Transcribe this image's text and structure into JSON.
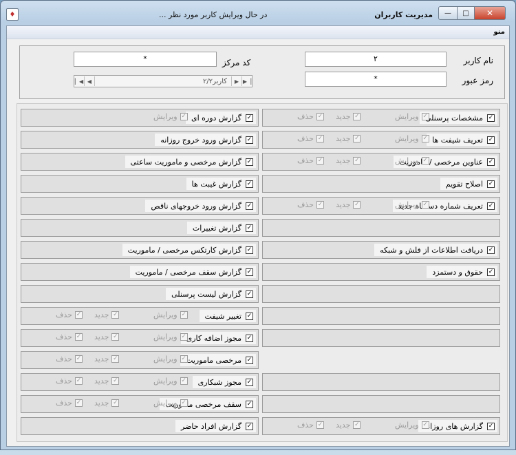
{
  "window": {
    "title": "مدیریت کاربران",
    "subtitle": "در حال ویرایش کاربر مورد نظر ...",
    "app_icon": "app-icon",
    "minimize_glyph": "—",
    "maximize_glyph": "□",
    "close_glyph": "✕"
  },
  "menu": {
    "label": "منو"
  },
  "form": {
    "username_label": "نام کاربر",
    "username_value": "٢",
    "password_label": "رمز عبور",
    "password_value": "*",
    "center_label": "کد مرکز",
    "center_value": "*",
    "nav_text": "کاربر۲/۲",
    "nav_first": "▏◀",
    "nav_prev": "◀",
    "nav_next": "▶",
    "nav_last": "▶▕"
  },
  "perm_labels": {
    "edit": "ویرایش",
    "new": "جدید",
    "delete": "حذف"
  },
  "check_glyph": "✓",
  "right_column": [
    {
      "label": "مشخصات پرسنلی",
      "perms": [
        "edit",
        "new",
        "delete"
      ]
    },
    {
      "label": "تعریف شیفت ها",
      "perms": [
        "edit",
        "new",
        "delete"
      ]
    },
    {
      "label": "عناوین مرخصی / ماموریت",
      "perms": [
        "edit",
        "new",
        "delete"
      ]
    },
    {
      "label": "اصلاح تقویم",
      "perms": []
    },
    {
      "label": "تعریف شماره دستگاه جدید",
      "perms": [
        "edit",
        "new",
        "delete"
      ]
    },
    {
      "label": "",
      "perms": []
    },
    {
      "label": "دریافت اطلاعات از فلش و شبکه",
      "perms": []
    },
    {
      "label": "حقوق و دستمزد",
      "perms": []
    },
    {
      "label": "",
      "perms": []
    },
    {
      "label": "",
      "perms": []
    },
    {
      "label": "",
      "perms": []
    },
    null,
    {
      "label": "",
      "perms": []
    },
    {
      "label": "",
      "perms": []
    },
    {
      "label": "گزارش های روزانه",
      "perms": [
        "edit",
        "new",
        "delete"
      ]
    }
  ],
  "left_column": [
    {
      "label": "گزارش دوره ای",
      "perms": [
        "edit"
      ]
    },
    {
      "label": "گزارش ورود خروج روزانه",
      "perms": []
    },
    {
      "label": "گزارش مرخصی و ماموریت ساعتی",
      "perms": []
    },
    {
      "label": "گزارش غیبت ها",
      "perms": []
    },
    {
      "label": "گزارش ورود خروجهای ناقص",
      "perms": []
    },
    {
      "label": "گزارش تغییرات",
      "perms": []
    },
    {
      "label": "گزارش کارتکس مرخصی / ماموریت",
      "perms": []
    },
    {
      "label": "گزارش سقف مرخصی / ماموریت",
      "perms": []
    },
    {
      "label": "گزارش لیست پرسنلی",
      "perms": []
    },
    {
      "label": "تغییر شیفت",
      "perms": [
        "edit",
        "new",
        "delete"
      ]
    },
    {
      "label": "مجوز اضافه کاری",
      "perms": [
        "edit",
        "new",
        "delete"
      ]
    },
    {
      "label": "مرخصی ماموریت",
      "perms": [
        "edit",
        "new",
        "delete"
      ]
    },
    {
      "label": "مجوز شبکاری",
      "perms": [
        "edit",
        "new",
        "delete"
      ]
    },
    {
      "label": "سقف مرخصی ماموریت",
      "perms": [
        "edit",
        "new",
        "delete"
      ]
    },
    {
      "label": "گزارش افراد حاضر",
      "perms": []
    }
  ]
}
